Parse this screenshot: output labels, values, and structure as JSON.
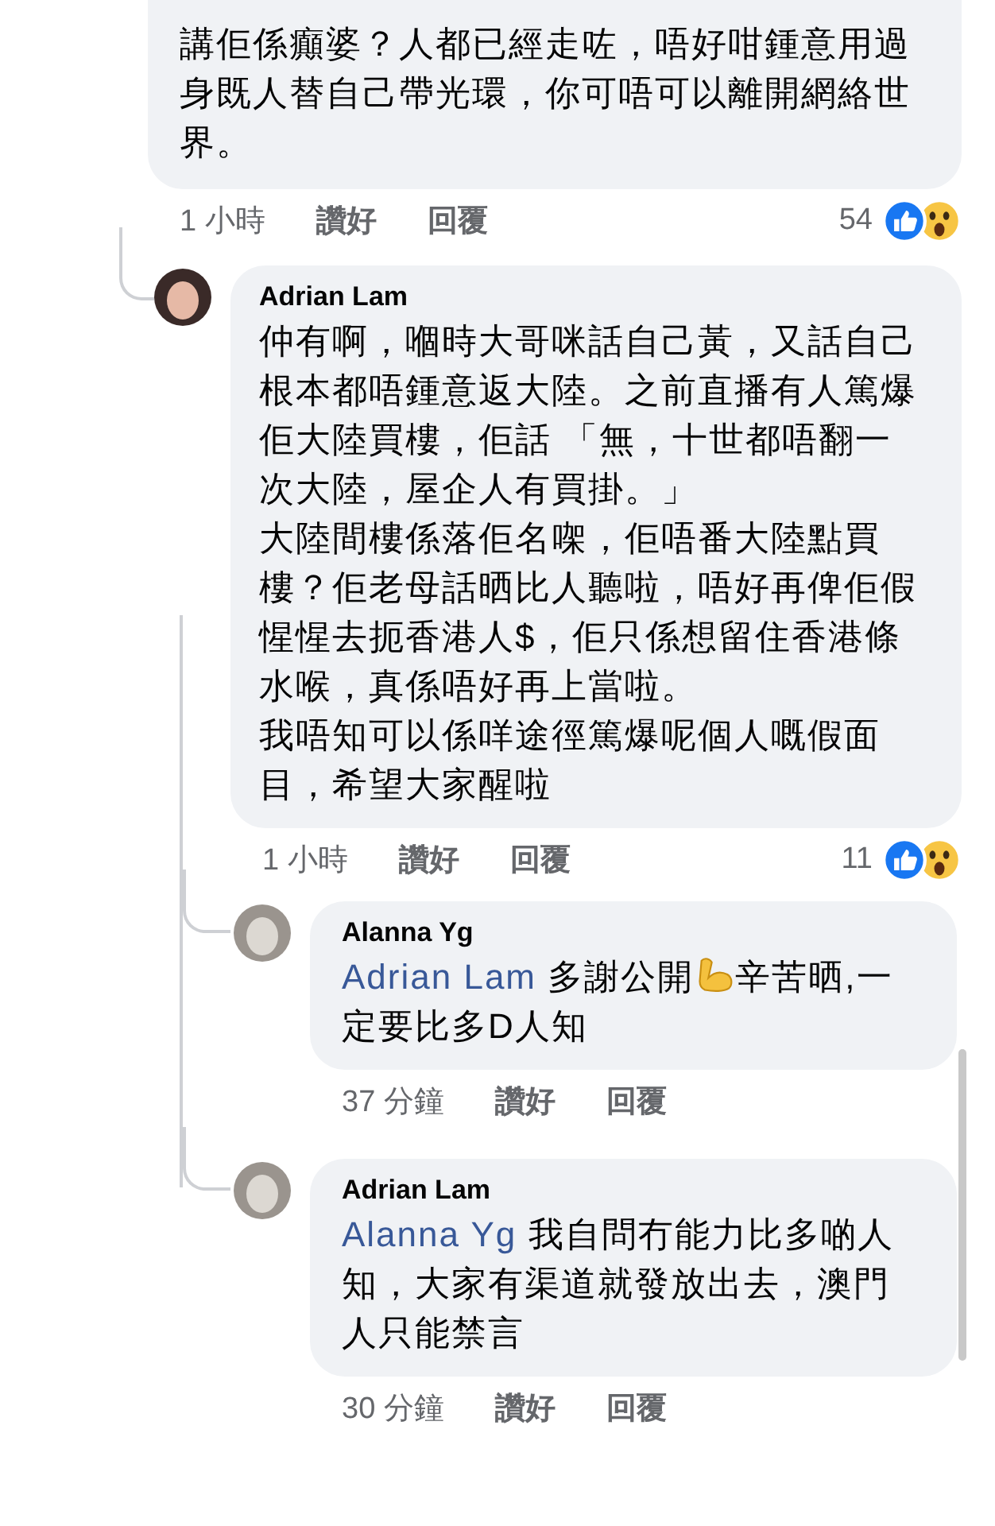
{
  "comments": [
    {
      "text": "講佢係癲婆？人都已經走咗，唔好咁鍾意用過身既人替自己帶光環，你可唔可以離開網絡世界。",
      "time": "1 小時",
      "like_label": "讚好",
      "reply_label": "回覆",
      "reaction_count": "54",
      "reactions": [
        {
          "kind": "like"
        },
        {
          "kind": "wow"
        }
      ]
    },
    {
      "author": "Adrian Lam",
      "paragraphs": [
        "仲有啊，嗰時大哥咪話自己黃，又話自己根本都唔鍾意返大陸。之前直播有人篤爆佢大陸買樓，佢話 「無，十世都唔翻一次大陸，屋企人有買掛。」",
        "大陸間樓係落佢名㗎，佢唔番大陸點買樓？佢老母話晒比人聽啦，唔好再俾佢假惺惺去扼香港人$，佢只係想留住香港條水喉，真係唔好再上當啦。",
        "我唔知可以係咩途徑篤爆呢個人嘅假面目，希望大家醒啦"
      ],
      "time": "1 小時",
      "like_label": "讚好",
      "reply_label": "回覆",
      "reaction_count": "11",
      "reactions": [
        {
          "kind": "like"
        },
        {
          "kind": "wow"
        }
      ],
      "replies": [
        {
          "author": "Alanna Yg",
          "body": [
            {
              "kind": "mention",
              "text": "Adrian Lam"
            },
            {
              "kind": "text",
              "text": "  多謝公開"
            },
            {
              "kind": "emoji"
            },
            {
              "kind": "text",
              "text": "辛苦晒,一定要比多D人知"
            }
          ],
          "time": "37 分鐘",
          "like_label": "讚好",
          "reply_label": "回覆"
        },
        {
          "author": "Adrian Lam",
          "body": [
            {
              "kind": "mention",
              "text": "Alanna Yg"
            },
            {
              "kind": "text",
              "text": " 我自問冇能力比多啲人知，大家有渠道就發放出去，澳門人只能禁言"
            }
          ],
          "time": "30 分鐘",
          "like_label": "讚好",
          "reply_label": "回覆"
        }
      ]
    }
  ]
}
